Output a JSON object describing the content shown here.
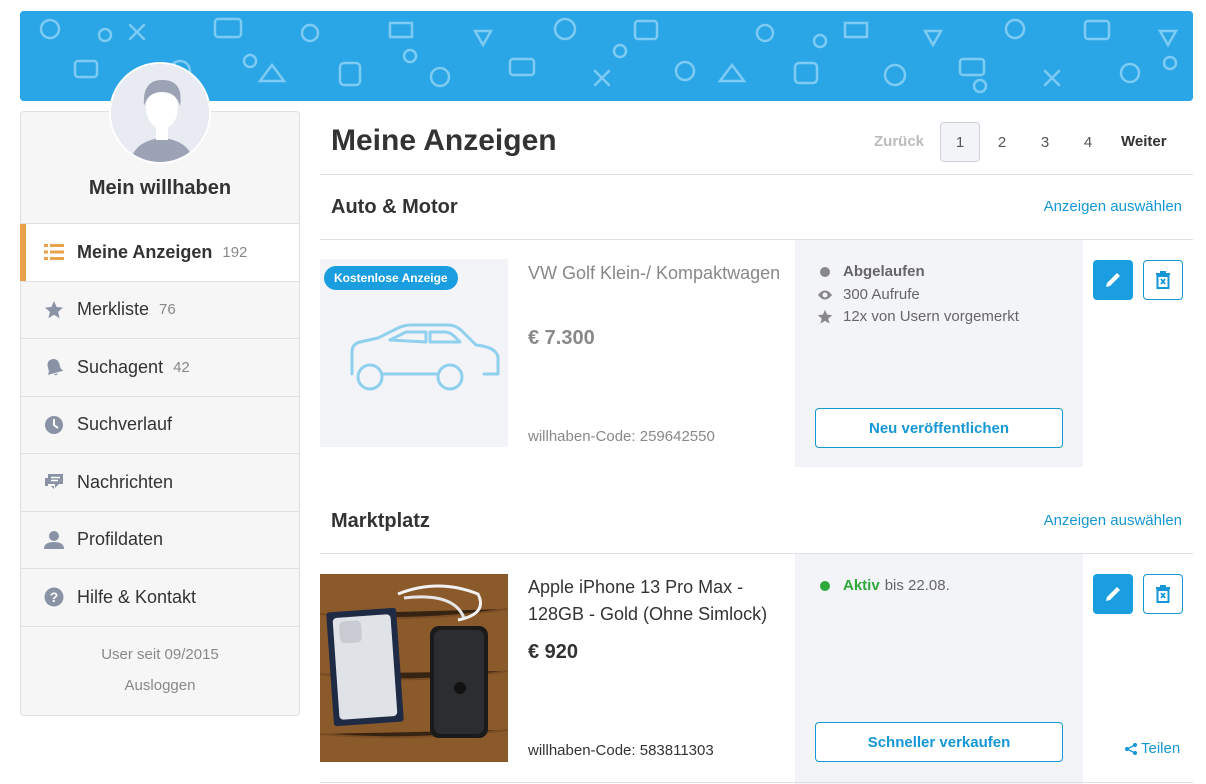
{
  "profile": {
    "name": "Mein willhaben"
  },
  "sidebar": {
    "items": [
      {
        "label": "Meine Anzeigen",
        "count": "192",
        "icon": "list-icon",
        "active": true
      },
      {
        "label": "Merkliste",
        "count": "76",
        "icon": "star-icon"
      },
      {
        "label": "Suchagent",
        "count": "42",
        "icon": "bell-icon"
      },
      {
        "label": "Suchverlauf",
        "count": "",
        "icon": "clock-icon"
      },
      {
        "label": "Nachrichten",
        "count": "",
        "icon": "chat-icon"
      },
      {
        "label": "Profildaten",
        "count": "",
        "icon": "person-icon"
      },
      {
        "label": "Hilfe & Kontakt",
        "count": "",
        "icon": "help-icon"
      }
    ],
    "member_since": "User seit 09/2015",
    "logout": "Ausloggen"
  },
  "main": {
    "title": "Meine Anzeigen"
  },
  "pagination": {
    "prev": "Zurück",
    "pages": [
      "1",
      "2",
      "3",
      "4"
    ],
    "current": "1",
    "next": "Weiter"
  },
  "sections": [
    {
      "title": "Auto & Motor",
      "select_label": "Anzeigen auswählen",
      "ad": {
        "badge": "Kostenlose Anzeige",
        "title": "VW Golf Klein-/ Kompaktwagen",
        "price": "€ 7.300",
        "code": "willhaben-Code: 259642550",
        "status": "Abgelaufen",
        "views": "300 Aufrufe",
        "saved": "12x von Usern vorgemerkt",
        "cta": "Neu veröffentlichen"
      }
    },
    {
      "title": "Marktplatz",
      "select_label": "Anzeigen auswählen",
      "ad": {
        "title": "Apple iPhone 13 Pro Max - 128GB - Gold (Ohne Simlock)",
        "price": "€ 920",
        "code": "willhaben-Code: 583811303",
        "status": "Aktiv",
        "status_until": "bis 22.08.",
        "cta": "Schneller verkaufen",
        "share": "Teilen"
      }
    }
  ],
  "colors": {
    "accent": "#1597d5",
    "banner": "#2aa6e6",
    "active_marker": "#e8a24a",
    "active_status": "#2ea83a"
  }
}
